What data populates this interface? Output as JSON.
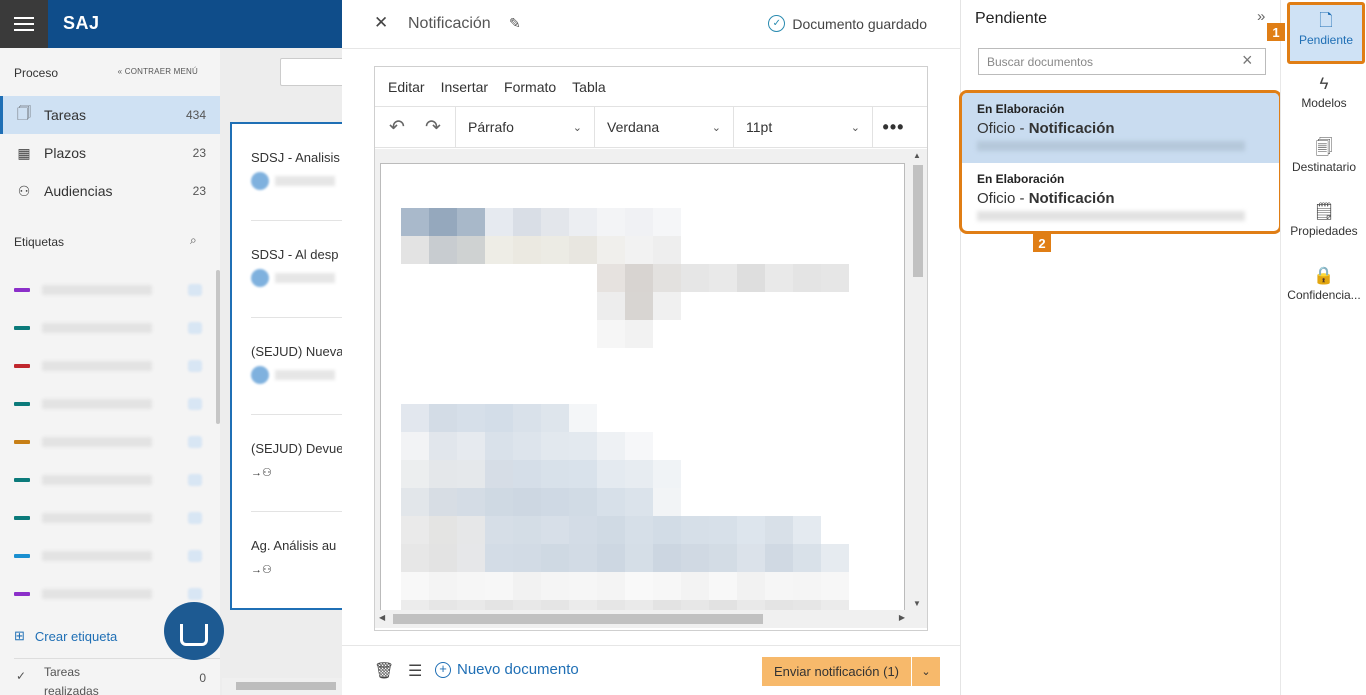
{
  "app": {
    "name": "SAJ"
  },
  "sidebar": {
    "section_title": "Proceso",
    "collapse_label": "CONTRAER MENÚ",
    "items": [
      {
        "label": "Tareas",
        "count": "434",
        "icon": "bookmark-icon"
      },
      {
        "label": "Plazos",
        "count": "23",
        "icon": "calendar-icon"
      },
      {
        "label": "Audiencias",
        "count": "23",
        "icon": "people-icon"
      }
    ],
    "labels_title": "Etiquetas",
    "tag_colors": [
      "#8b2fc9",
      "#0b7a7a",
      "#c0272d",
      "#0b7a7a",
      "#c77f16",
      "#0b7a7a",
      "#0b7a7a",
      "#1a8fd0",
      "#8b2fc9"
    ],
    "create_label": "Crear etiqueta",
    "done_label_1": "Tareas",
    "done_label_2": "realizadas",
    "done_count": "0"
  },
  "tasks": [
    {
      "title": "SDSJ - Analisis"
    },
    {
      "title": "SDSJ - Al desp"
    },
    {
      "title": "(SEJUD) Nueva"
    },
    {
      "title": "(SEJUD) Devue"
    },
    {
      "title": "Ag. Análisis au"
    }
  ],
  "editor": {
    "title": "Notificación",
    "saved_status": "Documento guardado",
    "menu": [
      "Editar",
      "Insertar",
      "Formato",
      "Tabla"
    ],
    "paragraph_style": "Párrafo",
    "font_family": "Verdana",
    "font_size": "11pt",
    "new_document_label": "Nuevo documento",
    "send_label": "Enviar notificación (1)"
  },
  "pending": {
    "title": "Pendiente",
    "search_placeholder": "Buscar documentos",
    "documents": [
      {
        "status": "En Elaboración",
        "type": "Oficio",
        "name": "Notificación",
        "selected": true
      },
      {
        "status": "En Elaboración",
        "type": "Oficio",
        "name": "Notificación",
        "selected": false
      }
    ],
    "badge_1": "1",
    "badge_2": "2"
  },
  "rail": {
    "items": [
      {
        "label": "Pendiente",
        "icon": "pending-doc-icon",
        "active": true
      },
      {
        "label": "Modelos",
        "icon": "bolt-icon",
        "active": false
      },
      {
        "label": "Destinatario",
        "icon": "doc-search-icon",
        "active": false
      },
      {
        "label": "Propiedades",
        "icon": "doc-properties-icon",
        "active": false
      },
      {
        "label": "Confidencia...",
        "icon": "lock-icon",
        "active": false
      }
    ]
  }
}
